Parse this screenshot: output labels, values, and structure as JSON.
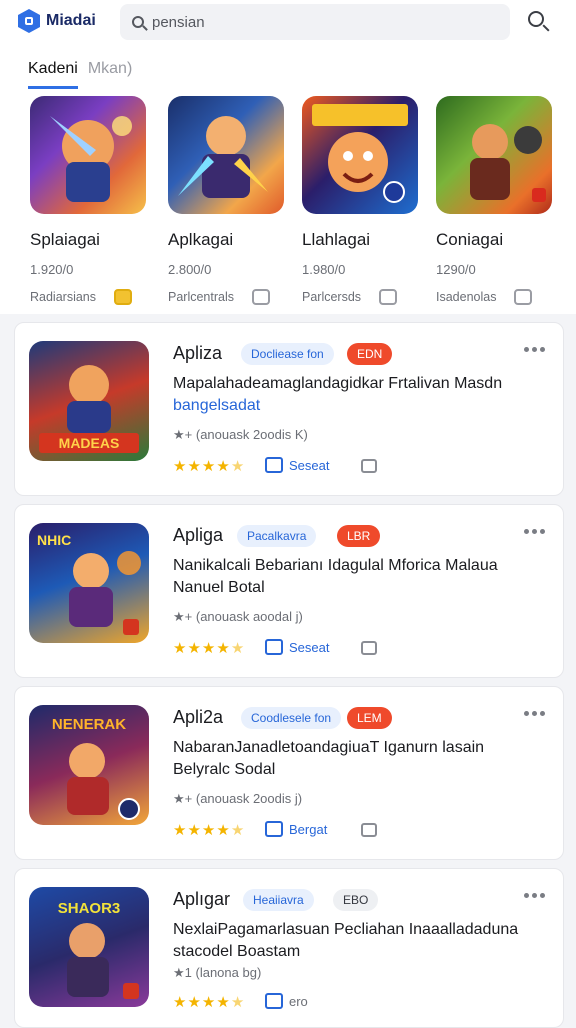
{
  "header": {
    "app_name": "Miadai",
    "search_value": "pensian",
    "search_placeholder": "pensian"
  },
  "tabs": [
    {
      "label": "Kadeni",
      "active": true
    },
    {
      "label": "Mkan)",
      "active": false
    }
  ],
  "featured": [
    {
      "name": "Splaiagai",
      "count": "1.920/0",
      "category": "Radiarsians",
      "badge": "gold",
      "icon": "hero-art-icon"
    },
    {
      "name": "Aplkagai",
      "count": "2.800/0",
      "category": "Parlcentrals",
      "badge": "grey",
      "icon": "hero-art-icon"
    },
    {
      "name": "Llahlagai",
      "count": "1.980/0",
      "category": "Parlcersds",
      "badge": "grey",
      "icon": "hero-art-icon"
    },
    {
      "name": "Coniagai",
      "count": "1290/0",
      "category": "Isadenolas",
      "badge": "grey",
      "icon": "hero-art-icon"
    }
  ],
  "list": [
    {
      "title": "Apliza",
      "chip1": "Docliease fon",
      "chip2": "EDN",
      "desc": "Mapalahadeamaglandagidkar Frtalivan Masdn",
      "link": "bangelsadat",
      "meta": "(anouask 2oodis K)",
      "rating": 4.5,
      "action": "Seseat",
      "icon_text": "MADEAS"
    },
    {
      "title": "Apliga",
      "chip1": "Pacalkavra",
      "chip2": "LBR",
      "desc": "Nanikalcali Bebarianı Idagulal Mforica Malaua",
      "link": "Nanuel Botal",
      "meta": "(anouask aoodal j)",
      "rating": 4.5,
      "action": "Seseat",
      "icon_text": "NHIC"
    },
    {
      "title": "Apli2a",
      "chip1": "Coodlesele fon",
      "chip2": "LEM",
      "desc": "NabaranJanadletoandagiuaT Iganurn lasain",
      "link": "Belyralc Sodal",
      "meta": "(anouask 2oodis j)",
      "rating": 4.5,
      "action": "Bergat",
      "icon_text": "NENERAK"
    },
    {
      "title": "Aplıgar",
      "chip1": "Heaiiavra",
      "chip2": "EBO",
      "desc": "NexlaiPagamarlasuan Pecliahan Inaaalladaduna",
      "link": "stacodel Boastam",
      "meta": "(lanona bg)",
      "rating": 4.5,
      "action": "ero",
      "icon_text": "SHAOR3"
    }
  ],
  "colors": {
    "accent": "#2f6fe4",
    "link": "#2766d8",
    "star": "#f4b400",
    "chip_red": "#ef4a2b"
  }
}
